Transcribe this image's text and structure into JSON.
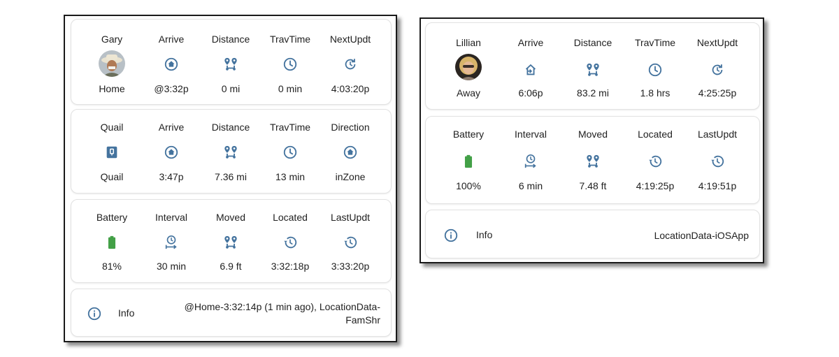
{
  "colors": {
    "icon": "#44739e",
    "battery": "#43a047",
    "card_border": "#e2e2e2"
  },
  "left": {
    "card1": {
      "cols": [
        {
          "label": "Gary",
          "icon": "avatar-man-hat",
          "value": "Home"
        },
        {
          "label": "Arrive",
          "icon": "home-circle-icon",
          "value": "@3:32p"
        },
        {
          "label": "Distance",
          "icon": "map-marker-distance-icon",
          "value": "0 mi"
        },
        {
          "label": "TravTime",
          "icon": "clock-outline-icon",
          "value": "0 min"
        },
        {
          "label": "NextUpdt",
          "icon": "refresh-clock-icon",
          "value": "4:03:20p"
        }
      ]
    },
    "card2": {
      "cols": [
        {
          "label": "Quail",
          "icon": "zone-badge-icon",
          "value": "Quail"
        },
        {
          "label": "Arrive",
          "icon": "home-circle-icon",
          "value": "3:47p"
        },
        {
          "label": "Distance",
          "icon": "map-marker-distance-icon",
          "value": "7.36 mi"
        },
        {
          "label": "TravTime",
          "icon": "clock-outline-icon",
          "value": "13 min"
        },
        {
          "label": "Direction",
          "icon": "home-circle-icon",
          "value": "inZone"
        }
      ]
    },
    "card3": {
      "cols": [
        {
          "label": "Battery",
          "icon": "battery-icon",
          "value": "81%"
        },
        {
          "label": "Interval",
          "icon": "timer-interval-icon",
          "value": "30 min"
        },
        {
          "label": "Moved",
          "icon": "map-marker-distance-icon",
          "value": "6.9 ft"
        },
        {
          "label": "Located",
          "icon": "history-icon",
          "value": "3:32:18p"
        },
        {
          "label": "LastUpdt",
          "icon": "history-icon",
          "value": "3:33:20p"
        }
      ]
    },
    "info": {
      "label": "Info",
      "line1": "@Home-3:32:14p (1 min ago), LocationData-",
      "line2": "FamShr"
    }
  },
  "right": {
    "card1": {
      "cols": [
        {
          "label": "Lillian",
          "icon": "avatar-woman",
          "value": "Away"
        },
        {
          "label": "Arrive",
          "icon": "home-import-icon",
          "value": "6:06p"
        },
        {
          "label": "Distance",
          "icon": "map-marker-distance-icon",
          "value": "83.2 mi"
        },
        {
          "label": "TravTime",
          "icon": "clock-outline-icon",
          "value": "1.8 hrs"
        },
        {
          "label": "NextUpdt",
          "icon": "refresh-clock-icon",
          "value": "4:25:25p"
        }
      ]
    },
    "card2": {
      "cols": [
        {
          "label": "Battery",
          "icon": "battery-icon",
          "value": "100%"
        },
        {
          "label": "Interval",
          "icon": "timer-interval-icon",
          "value": "6 min"
        },
        {
          "label": "Moved",
          "icon": "map-marker-distance-icon",
          "value": "7.48 ft"
        },
        {
          "label": "Located",
          "icon": "history-icon",
          "value": "4:19:25p"
        },
        {
          "label": "LastUpdt",
          "icon": "history-icon",
          "value": "4:19:51p"
        }
      ]
    },
    "info": {
      "label": "Info",
      "text": "LocationData-iOSApp"
    }
  }
}
